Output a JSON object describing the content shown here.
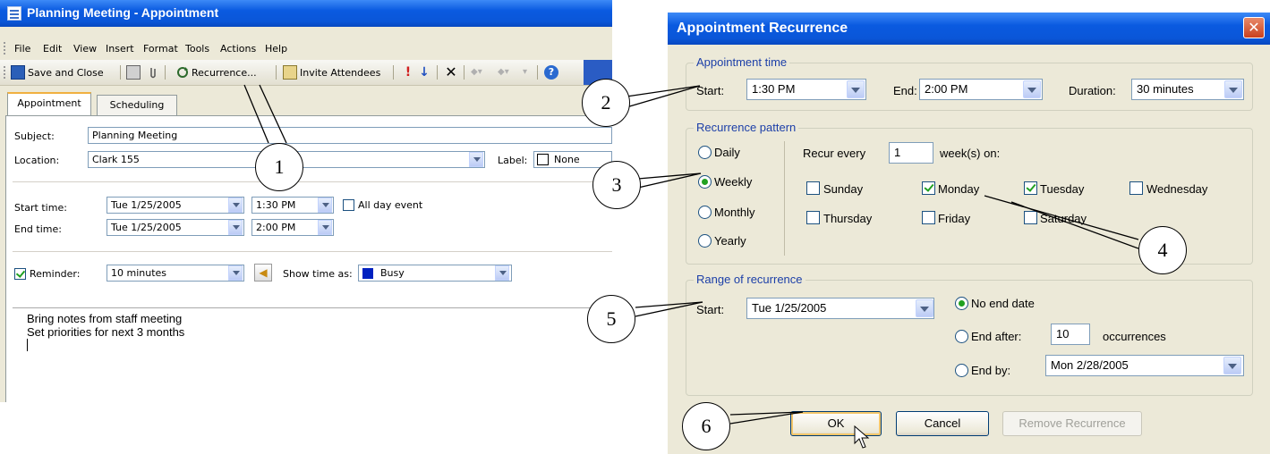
{
  "appointment_window": {
    "title": "Planning Meeting - Appointment",
    "menu": [
      "File",
      "Edit",
      "View",
      "Insert",
      "Format",
      "Tools",
      "Actions",
      "Help"
    ],
    "toolbar": {
      "save_close": "Save and Close",
      "recurrence": "Recurrence...",
      "invite": "Invite Attendees"
    },
    "tabs": [
      "Appointment",
      "Scheduling"
    ],
    "subject_label": "Subject:",
    "subject": "Planning Meeting",
    "location_label": "Location:",
    "location": "Clark 155",
    "label_label": "Label:",
    "label_value": "None",
    "start_label": "Start time:",
    "start_date": "Tue 1/25/2005",
    "start_time": "1:30 PM",
    "all_day": "All day event",
    "end_label": "End time:",
    "end_date": "Tue 1/25/2005",
    "end_time": "2:00 PM",
    "reminder_label": "Reminder:",
    "reminder": "10 minutes",
    "show_time_label": "Show time as:",
    "show_time": "Busy",
    "notes": [
      "Bring notes from staff meeting",
      "Set priorities for next 3 months"
    ]
  },
  "recurrence_dialog": {
    "title": "Appointment Recurrence",
    "appointment_time": {
      "legend": "Appointment time",
      "start_label": "Start:",
      "start": "1:30 PM",
      "end_label": "End:",
      "end": "2:00 PM",
      "duration_label": "Duration:",
      "duration": "30 minutes"
    },
    "pattern": {
      "legend": "Recurrence pattern",
      "options": [
        "Daily",
        "Weekly",
        "Monthly",
        "Yearly"
      ],
      "recur_every_label": "Recur every",
      "recur_every": "1",
      "weeks_on": "week(s) on:",
      "days": [
        "Sunday",
        "Monday",
        "Tuesday",
        "Wednesday",
        "Thursday",
        "Friday",
        "Saturday"
      ]
    },
    "range": {
      "legend": "Range of recurrence",
      "start_label": "Start:",
      "start": "Tue 1/25/2005",
      "no_end": "No end date",
      "end_after": "End after:",
      "occurrences": "10",
      "occurrences_label": "occurrences",
      "end_by": "End by:",
      "end_by_date": "Mon 2/28/2005"
    },
    "buttons": {
      "ok": "OK",
      "cancel": "Cancel",
      "remove": "Remove Recurrence"
    }
  },
  "callouts": [
    "1",
    "2",
    "3",
    "4",
    "5",
    "6"
  ]
}
